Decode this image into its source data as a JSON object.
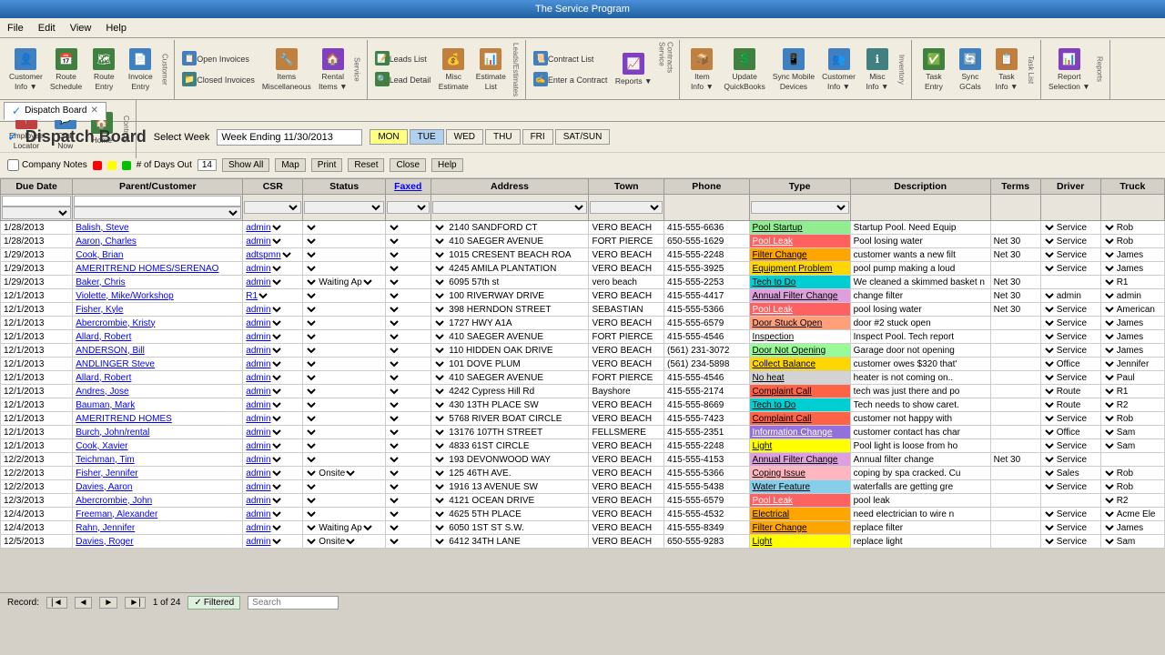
{
  "window": {
    "title": "The Service Program"
  },
  "menu": {
    "items": [
      "File",
      "Edit",
      "View",
      "Help"
    ]
  },
  "toolbar": {
    "groups": [
      {
        "name": "Customer",
        "buttons": [
          {
            "label": "Customer\nInfo ▼",
            "icon": "👤",
            "color": "blue"
          },
          {
            "label": "Route\nSchedule",
            "icon": "📅",
            "color": "green"
          },
          {
            "label": "Route\nEntry",
            "icon": "🗺",
            "color": "green"
          },
          {
            "label": "Invoice\nEntry",
            "icon": "📄",
            "color": "blue"
          }
        ]
      },
      {
        "name": "Service",
        "buttons": [
          {
            "label": "Open Invoices",
            "icon": "📋",
            "color": "blue"
          },
          {
            "label": "Closed Invoices",
            "icon": "📁",
            "color": "teal"
          },
          {
            "label": "Items\nMiscellaneous",
            "icon": "🔧",
            "color": "orange"
          },
          {
            "label": "Rental\nItems ▼",
            "icon": "🏠",
            "color": "purple"
          }
        ]
      },
      {
        "name": "LeadsEstimates",
        "buttons": [
          {
            "label": "Leads List",
            "icon": "📝",
            "color": "green"
          },
          {
            "label": "Lead Detail",
            "icon": "🔍",
            "color": "green"
          },
          {
            "label": "Misc\nEstimate",
            "icon": "💰",
            "color": "orange"
          },
          {
            "label": "Estimate List",
            "icon": "📊",
            "color": "orange"
          }
        ]
      },
      {
        "name": "ServiceContracts",
        "buttons": [
          {
            "label": "Contract List",
            "icon": "📜",
            "color": "blue"
          },
          {
            "label": "Enter a Contract",
            "icon": "✍",
            "color": "blue"
          },
          {
            "label": "Reports ▼",
            "icon": "📈",
            "color": "purple"
          }
        ]
      },
      {
        "name": "Inventory",
        "buttons": [
          {
            "label": "Item\nInfo ▼",
            "icon": "📦",
            "color": "orange"
          },
          {
            "label": "Update\nQuickBooks",
            "icon": "💲",
            "color": "green"
          },
          {
            "label": "Sync Mobile\nDevices",
            "icon": "📱",
            "color": "blue"
          },
          {
            "label": "Customer\nInfo ▼",
            "icon": "👥",
            "color": "blue"
          },
          {
            "label": "Misc\nInfo ▼",
            "icon": "ℹ",
            "color": "teal"
          }
        ]
      },
      {
        "name": "TaskList",
        "buttons": [
          {
            "label": "Task\nEntry",
            "icon": "✅",
            "color": "green"
          },
          {
            "label": "Sync\nQCals",
            "icon": "🔄",
            "color": "blue"
          },
          {
            "label": "Task\nInfo ▼",
            "icon": "📋",
            "color": "orange"
          }
        ]
      },
      {
        "name": "Reports",
        "buttons": [
          {
            "label": "Report\nSelection ▼",
            "icon": "📊",
            "color": "purple"
          }
        ]
      },
      {
        "name": "Controls",
        "buttons": [
          {
            "label": "Employee\nLocator",
            "icon": "📍",
            "color": "red"
          },
          {
            "label": "Chat\nNow",
            "icon": "💬",
            "color": "blue"
          },
          {
            "label": "Home",
            "icon": "🏠",
            "color": "green"
          }
        ]
      }
    ]
  },
  "tab": {
    "label": "Dispatch Board",
    "active": true
  },
  "dispatch": {
    "title": "Dispatch Board",
    "checkbox_label": "✓",
    "select_week_label": "Select Week",
    "week_value": "Week Ending 11/30/2013",
    "days": [
      "MON",
      "TUE",
      "WED",
      "THU",
      "FRI",
      "SAT/SUN"
    ],
    "company_notes_label": "Company Notes",
    "legend_label": "# of Days Out",
    "days_out_count": "14",
    "show_all_label": "Show All",
    "map_label": "Map",
    "print_label": "Print",
    "reset_label": "Reset",
    "close_label": "Close",
    "help_label": "Help"
  },
  "table": {
    "columns": [
      "Due Date",
      "Parent/Customer",
      "CSR",
      "Status",
      "Faxed",
      "Address",
      "Town",
      "Phone",
      "Type",
      "Description",
      "Terms",
      "Driver",
      "Truck"
    ],
    "rows": [
      {
        "date": "1/28/2013",
        "customer": "Balish, Steve",
        "csr": "admin",
        "status": "",
        "faxed": "",
        "address": "2140 SANDFORD CT",
        "town": "VERO BEACH",
        "phone": "415-555-6636",
        "type": "Pool Startup",
        "type_color": "",
        "description": "Startup Pool.  Need Equip",
        "terms": "",
        "driver": "Service",
        "truck": "Rob"
      },
      {
        "date": "1/28/2013",
        "customer": "Aaron, Charles",
        "csr": "admin",
        "status": "",
        "faxed": "",
        "address": "410 SAEGER AVENUE",
        "town": "FORT PIERCE",
        "phone": "650-555-1629",
        "type": "Pool Leak",
        "type_color": "pool-leak",
        "description": "Pool losing water",
        "terms": "Net 30",
        "driver": "Service",
        "truck": "Rob"
      },
      {
        "date": "1/29/2013",
        "customer": "Cook, Brian",
        "csr": "adtspmn",
        "status": "",
        "faxed": "",
        "address": "1015 CRESENT BEACH ROA",
        "town": "VERO BEACH",
        "phone": "415-555-2248",
        "type": "Filter Change",
        "type_color": "filter-change",
        "description": "customer wants a new filt",
        "terms": "Net 30",
        "driver": "Service",
        "truck": "James"
      },
      {
        "date": "1/29/2013",
        "customer": "AMERITREND HOMES/SERENAO",
        "csr": "admin",
        "status": "",
        "faxed": "",
        "address": "4245 AMILA PLANTATION",
        "town": "VERO BEACH",
        "phone": "415-555-3925",
        "type": "Equipment Problem",
        "type_color": "equipment",
        "description": "pool pump making a loud",
        "terms": "",
        "driver": "Service",
        "truck": "James"
      },
      {
        "date": "1/29/2013",
        "customer": "Baker, Chris",
        "csr": "admin",
        "status": "Waiting Ap",
        "faxed": "",
        "address": "6095 57th st",
        "town": "vero beach",
        "phone": "415-555-2253",
        "type": "Tech to Do",
        "type_color": "tech-to-do",
        "description": "We cleaned a skimmed basket n",
        "terms": "Net 30",
        "driver": "",
        "truck": "R1"
      },
      {
        "date": "12/1/2013",
        "customer": "Violette, Mike/Workshop",
        "csr": "R1",
        "status": "",
        "faxed": "",
        "address": "100 RIVERWAY DRIVE",
        "town": "VERO BEACH",
        "phone": "415-555-4417",
        "type": "Annual Filter Change",
        "type_color": "filter-change-annual",
        "description": "change filter",
        "terms": "Net 30",
        "driver": "admin",
        "truck": "admin"
      },
      {
        "date": "12/1/2013",
        "customer": "Fisher, Kyle",
        "csr": "admin",
        "status": "",
        "faxed": "",
        "address": "398 HERNDON STREET",
        "town": "SEBASTIAN",
        "phone": "415-555-5366",
        "type": "Pool Leak",
        "type_color": "pool-leak",
        "description": "pool losing water",
        "terms": "Net 30",
        "driver": "Service",
        "truck": "American"
      },
      {
        "date": "12/1/2013",
        "customer": "Abercrombie, Kristy",
        "csr": "admin",
        "status": "",
        "faxed": "",
        "address": "1727 HWY A1A",
        "town": "VERO BEACH",
        "phone": "415-555-6579",
        "type": "Door Stuck Open",
        "type_color": "door-stuck",
        "description": "door #2 stuck open",
        "terms": "",
        "driver": "Service",
        "truck": "James"
      },
      {
        "date": "12/1/2013",
        "customer": "Allard, Robert",
        "csr": "admin",
        "status": "",
        "faxed": "",
        "address": "410 SAEGER AVENUE",
        "town": "FORT PIERCE",
        "phone": "415-555-4546",
        "type": "Inspection",
        "type_color": "inspection",
        "description": "Inspect Pool. Tech report",
        "terms": "",
        "driver": "Service",
        "truck": "James"
      },
      {
        "date": "12/1/2013",
        "customer": "ANDERSON, Bill",
        "csr": "admin",
        "status": "",
        "faxed": "",
        "address": "110 HIDDEN OAK DRIVE",
        "town": "VERO BEACH",
        "phone": "(561) 231-3072",
        "type": "Door Not Opening",
        "type_color": "door-not",
        "description": "Garage door not opening",
        "terms": "",
        "driver": "Service",
        "truck": "James"
      },
      {
        "date": "12/1/2013",
        "customer": "ANDLINGER Steve",
        "csr": "admin",
        "status": "",
        "faxed": "",
        "address": "101 DOVE PLUM",
        "town": "VERO BEACH",
        "phone": "(561) 234-5898",
        "type": "Collect Balance",
        "type_color": "collect",
        "description": "customer owes $320 that'",
        "terms": "",
        "driver": "Office",
        "truck": "Jennifer"
      },
      {
        "date": "12/1/2013",
        "customer": "Allard, Robert",
        "csr": "admin",
        "status": "",
        "faxed": "",
        "address": "410 SAEGER AVENUE",
        "town": "FORT PIERCE",
        "phone": "415-555-4546",
        "type": "No heat",
        "type_color": "no-heat",
        "description": "heater is not coming on..",
        "terms": "",
        "driver": "Service",
        "truck": "Paul"
      },
      {
        "date": "12/1/2013",
        "customer": "Andres, Jose",
        "csr": "admin",
        "status": "",
        "faxed": "",
        "address": "4242 Cypress Hill Rd",
        "town": "Bayshore",
        "phone": "415-555-2174",
        "type": "Complaint Call",
        "type_color": "complaint",
        "description": "tech was just there and po",
        "terms": "",
        "driver": "Route",
        "truck": "R1"
      },
      {
        "date": "12/1/2013",
        "customer": "Bauman, Mark",
        "csr": "admin",
        "status": "",
        "faxed": "",
        "address": "430 13TH PLACE SW",
        "town": "VERO BEACH",
        "phone": "415-555-8669",
        "type": "Tech to Do",
        "type_color": "tech-to-do",
        "description": "Tech needs to show caret.",
        "terms": "",
        "driver": "Route",
        "truck": "R2"
      },
      {
        "date": "12/1/2013",
        "customer": "AMERITREND HOMES",
        "csr": "admin",
        "status": "",
        "faxed": "",
        "address": "5768 RIVER BOAT CIRCLE",
        "town": "VERO BEACH",
        "phone": "415-555-7423",
        "type": "Complaint Call",
        "type_color": "complaint2",
        "description": "customer not happy with",
        "terms": "",
        "driver": "Service",
        "truck": "Rob"
      },
      {
        "date": "12/1/2013",
        "customer": "Burch, John/rental",
        "csr": "admin",
        "status": "",
        "faxed": "",
        "address": "13176 107TH STREET",
        "town": "FELLSMERE",
        "phone": "415-555-2351",
        "type": "Information Change",
        "type_color": "info-change",
        "description": "customer contact has char",
        "terms": "",
        "driver": "Office",
        "truck": "Sam"
      },
      {
        "date": "12/1/2013",
        "customer": "Cook, Xavier",
        "csr": "admin",
        "status": "",
        "faxed": "",
        "address": "4833 61ST CIRCLE",
        "town": "VERO BEACH",
        "phone": "415-555-2248",
        "type": "Light",
        "type_color": "light",
        "description": "Pool light is loose from ho",
        "terms": "",
        "driver": "Service",
        "truck": "Sam"
      },
      {
        "date": "12/2/2013",
        "customer": "Teichman, Tim",
        "csr": "admin",
        "status": "",
        "faxed": "",
        "address": "193 DEVONWOOD WAY",
        "town": "VERO BEACH",
        "phone": "415-555-4153",
        "type": "Annual Filter Change",
        "type_color": "filter-change-annual",
        "description": "Annual filter change",
        "terms": "Net 30",
        "driver": "Service",
        "truck": ""
      },
      {
        "date": "12/2/2013",
        "customer": "Fisher, Jennifer",
        "csr": "admin",
        "status": "Onsite",
        "faxed": "",
        "address": "125 46TH AVE.",
        "town": "VERO BEACH",
        "phone": "415-555-5366",
        "type": "Coping Issue",
        "type_color": "coping",
        "description": "coping by spa cracked. Cu",
        "terms": "",
        "driver": "Sales",
        "truck": "Rob"
      },
      {
        "date": "12/2/2013",
        "customer": "Davies, Aaron",
        "csr": "admin",
        "status": "",
        "faxed": "",
        "address": "1916 13 AVENUE SW",
        "town": "VERO BEACH",
        "phone": "415-555-5438",
        "type": "Water Feature",
        "type_color": "water-feature",
        "description": "waterfalls are getting gre",
        "terms": "",
        "driver": "Service",
        "truck": "Rob"
      },
      {
        "date": "12/3/2013",
        "customer": "Abercrombie, John",
        "csr": "admin",
        "status": "",
        "faxed": "",
        "address": "4121 OCEAN DRIVE",
        "town": "VERO BEACH",
        "phone": "415-555-6579",
        "type": "Pool Leak",
        "type_color": "pool-leak3",
        "description": "pool leak",
        "terms": "",
        "driver": "",
        "truck": "R2"
      },
      {
        "date": "12/4/2013",
        "customer": "Freeman, Alexander",
        "csr": "admin",
        "status": "",
        "faxed": "",
        "address": "4625 5TH PLACE",
        "town": "VERO BEACH",
        "phone": "415-555-4532",
        "type": "Electrical",
        "type_color": "electrical",
        "description": "need electrician to wire n",
        "terms": "",
        "driver": "Service",
        "truck": "Acme Ele"
      },
      {
        "date": "12/4/2013",
        "customer": "Rahn, Jennifer",
        "csr": "admin",
        "status": "Waiting Ap",
        "faxed": "",
        "address": "6050  1ST ST S.W.",
        "town": "VERO BEACH",
        "phone": "415-555-8349",
        "type": "Filter Change",
        "type_color": "filter-change2",
        "description": "replace filter",
        "terms": "",
        "driver": "Service",
        "truck": "James"
      },
      {
        "date": "12/5/2013",
        "customer": "Davies, Roger",
        "csr": "admin",
        "status": "Onsite",
        "faxed": "",
        "address": "6412 34TH LANE",
        "town": "VERO BEACH",
        "phone": "650-555-9283",
        "type": "Light",
        "type_color": "light2",
        "description": "replace light",
        "terms": "",
        "driver": "Service",
        "truck": "Sam"
      }
    ]
  },
  "statusbar": {
    "record_label": "Record:",
    "nav_first": "|◄",
    "nav_prev": "◄",
    "nav_next": "►",
    "nav_last": "►|",
    "record_info": "1 of 24",
    "filtered_label": "Filtered",
    "search_placeholder": "Search"
  },
  "type_colors": {
    "pool-leak": "#ff6060",
    "pool-leak3": "#ff6060",
    "filter-change": "#FFA500",
    "filter-change2": "#FFA500",
    "filter-change-annual": "#DDA0DD",
    "equipment": "#FFD700",
    "tech-to-do": "#00CED1",
    "inspection": "#ffffff",
    "door-not": "#98FB98",
    "door-stuck": "#FFA07A",
    "collect": "#FFD700",
    "no-heat": "#D3D3D3",
    "complaint": "#FF6347",
    "complaint2": "#FF6347",
    "info-change": "#9370DB",
    "light": "#FFFF00",
    "light2": "#FFFF00",
    "annual-filter": "#DDA0DD",
    "coping": "#FFB6C1",
    "water-feature": "#87CEEB",
    "electrical": "#FFA500",
    "pool-startup": "#90EE90"
  }
}
